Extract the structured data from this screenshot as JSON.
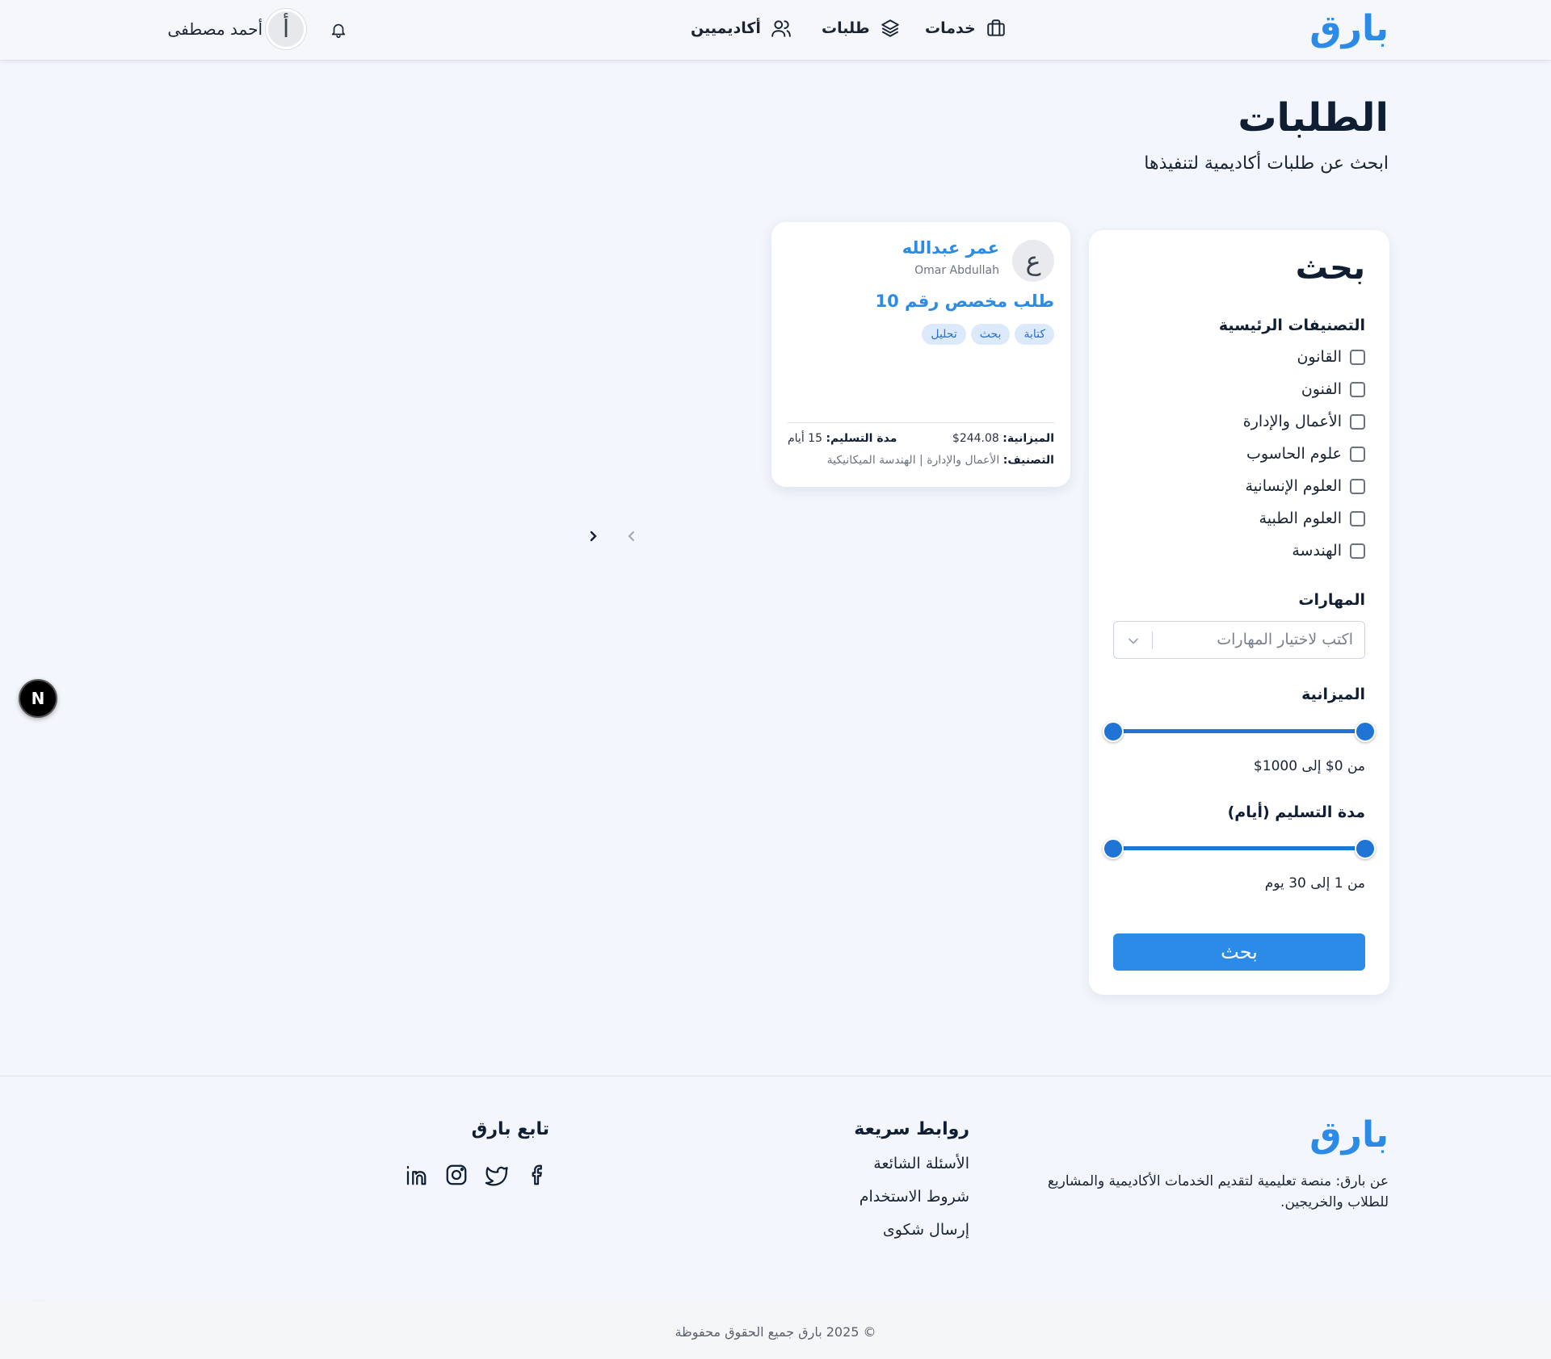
{
  "header": {
    "logo": "بارق",
    "nav": [
      {
        "label": "خدمات",
        "icon": "briefcase-icon"
      },
      {
        "label": "طلبات",
        "icon": "layers-icon"
      },
      {
        "label": "أكاديميين",
        "icon": "users-icon"
      }
    ],
    "user_name": "أحمد مصطفى",
    "user_initial": "أ"
  },
  "page": {
    "title": "الطلبات",
    "subtitle": "ابحث عن طلبات أكاديمية لتنفيذها"
  },
  "filters": {
    "title": "بحث",
    "categories_label": "التصنيفات الرئيسية",
    "categories": [
      "القانون",
      "الفنون",
      "الأعمال والإدارة",
      "علوم الحاسوب",
      "العلوم الإنسانية",
      "العلوم الطبية",
      "الهندسة"
    ],
    "skills_label": "المهارات",
    "skills_placeholder": "اكتب لاختيار المهارات",
    "budget_label": "الميزانية",
    "budget_range_text": "من 0$ إلى 1000$",
    "budget_min": 0,
    "budget_max": 1000,
    "delivery_label": "مدة التسليم (أيام)",
    "delivery_range_text": "من 1 إلى 30 يوم",
    "delivery_min": 1,
    "delivery_max": 30,
    "search_button": "بحث"
  },
  "request_card": {
    "avatar_initial": "ع",
    "name": "عمر عبدالله",
    "name_en": "Omar Abdullah",
    "title": "طلب مخصص رقم 10",
    "tags": [
      "كتابة",
      "بحث",
      "تحليل"
    ],
    "budget_label": "الميزانية:",
    "budget_value": "244.08$",
    "delivery_label": "مدة التسليم:",
    "delivery_value": "15 أيام",
    "category_label": "التصنيف:",
    "category_value": "الأعمال والإدارة | الهندسة الميكانيكية"
  },
  "badges": {
    "n1": "N",
    "n2": "N"
  },
  "footer": {
    "logo": "بارق",
    "about": "عن بارق: منصة تعليمية لتقديم الخدمات الأكاديمية والمشاريع للطلاب والخريجين.",
    "quick_links_title": "روابط سريعة",
    "quick_links": [
      "الأسئلة الشائعة",
      "شروط الاستخدام",
      "إرسال شكوى"
    ],
    "follow_title": "تابع بارق",
    "social": [
      "facebook-icon",
      "twitter-icon",
      "instagram-icon",
      "linkedin-icon"
    ],
    "copyright": "© 2025 بارق جميع الحقوق محفوظة"
  }
}
